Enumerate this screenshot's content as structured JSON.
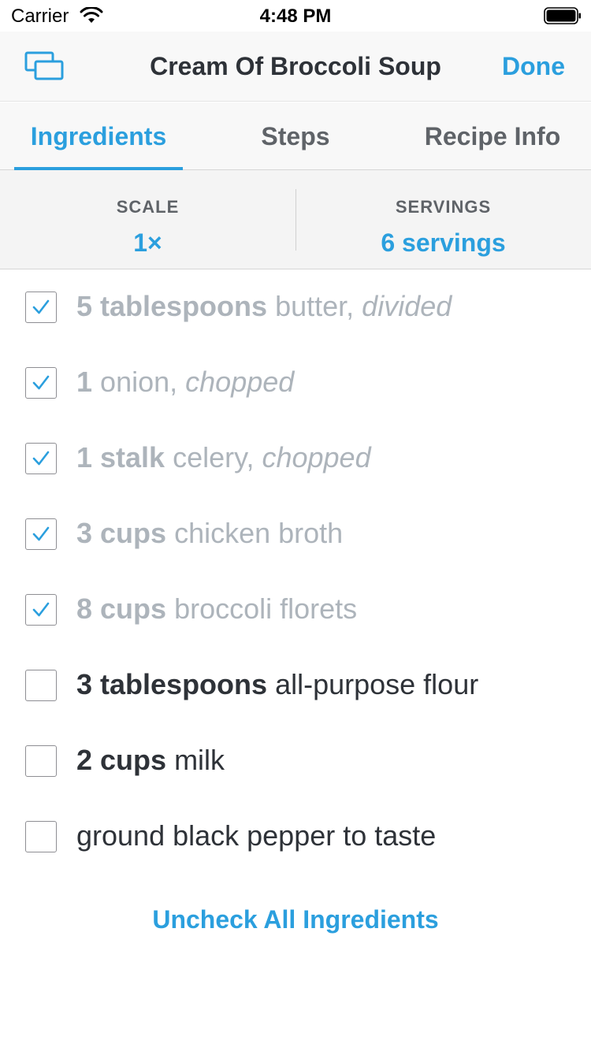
{
  "status_bar": {
    "carrier": "Carrier",
    "time": "4:48 PM"
  },
  "nav": {
    "title": "Cream Of Broccoli Soup",
    "done_label": "Done",
    "left_icon": "switch-windows-icon"
  },
  "tabs": [
    {
      "label": "Ingredients",
      "active": true
    },
    {
      "label": "Steps",
      "active": false
    },
    {
      "label": "Recipe Info",
      "active": false
    }
  ],
  "scale": {
    "label": "SCALE",
    "value": "1×"
  },
  "servings": {
    "label": "SERVINGS",
    "value": "6 servings"
  },
  "ingredients": [
    {
      "quantity": "5 tablespoons",
      "item": "butter,",
      "note": "divided",
      "checked": true
    },
    {
      "quantity": "1",
      "item": "onion,",
      "note": "chopped",
      "checked": true
    },
    {
      "quantity": "1 stalk",
      "item": "celery,",
      "note": "chopped",
      "checked": true
    },
    {
      "quantity": "3 cups",
      "item": "chicken broth",
      "note": "",
      "checked": true
    },
    {
      "quantity": "8 cups",
      "item": "broccoli florets",
      "note": "",
      "checked": true
    },
    {
      "quantity": "3 tablespoons",
      "item": "all-purpose flour",
      "note": "",
      "checked": false
    },
    {
      "quantity": "2 cups",
      "item": "milk",
      "note": "",
      "checked": false
    },
    {
      "quantity": "",
      "item": "ground black pepper to taste",
      "note": "",
      "checked": false
    }
  ],
  "uncheck_all_label": "Uncheck All Ingredients",
  "colors": {
    "accent": "#2b9fde",
    "text": "#2e3238",
    "checked_text": "#adb4bb",
    "bar_bg": "#f8f8f8"
  }
}
